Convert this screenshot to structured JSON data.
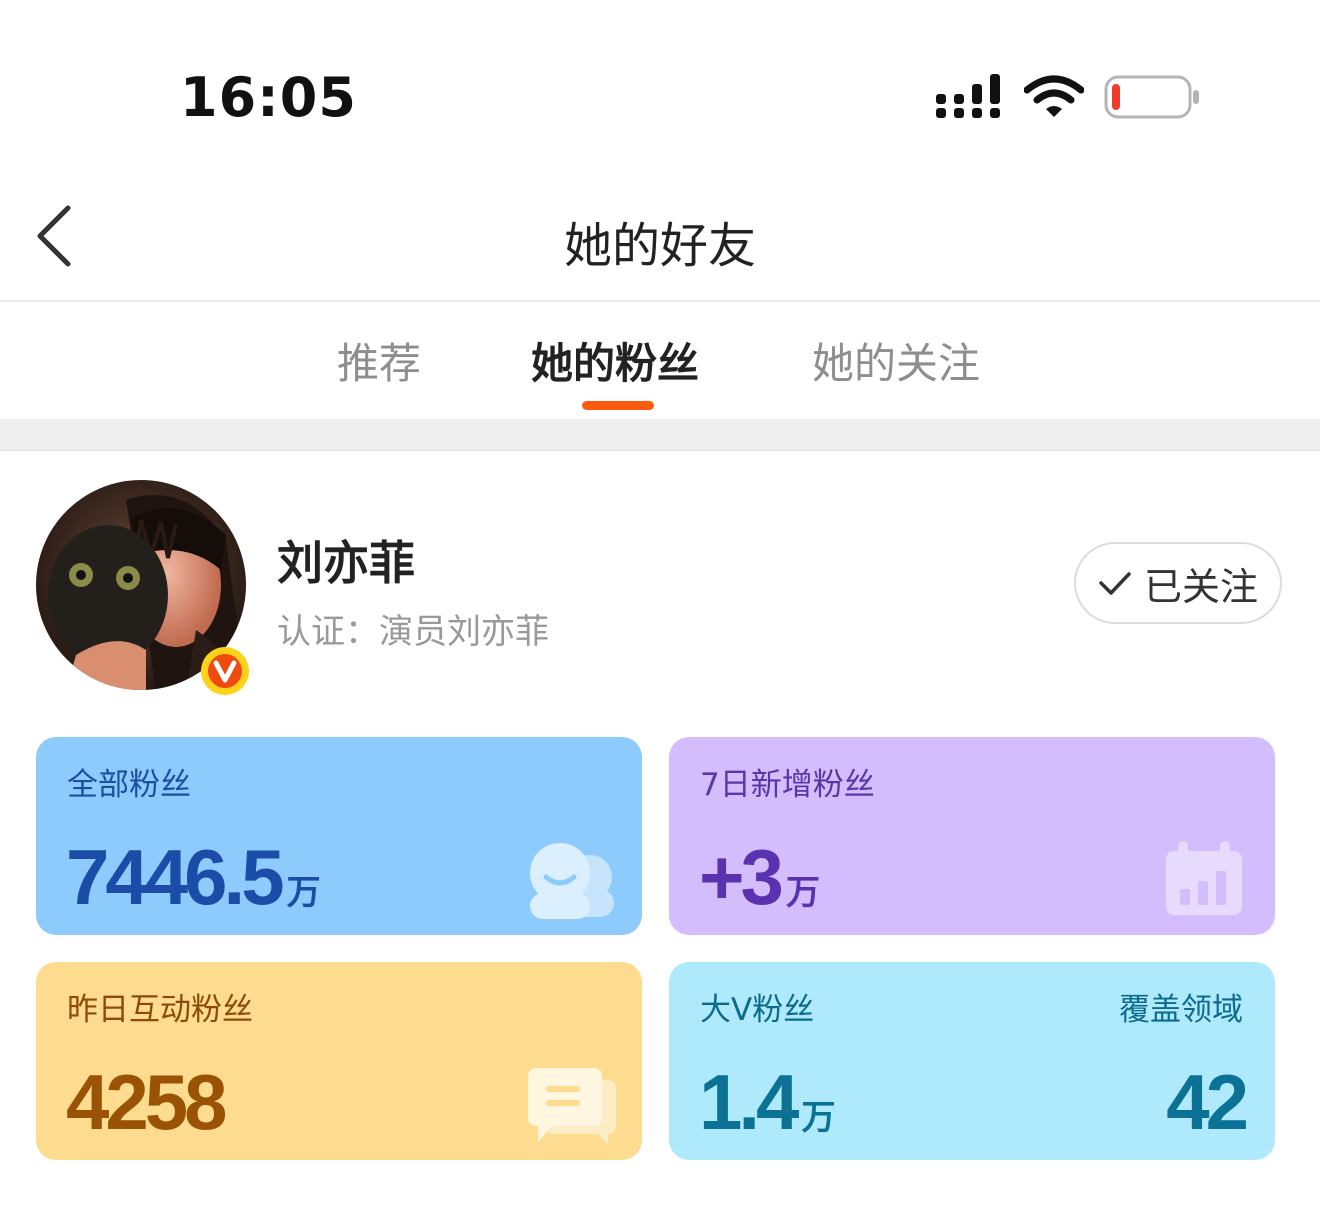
{
  "status_bar": {
    "time": "16:05",
    "signal_icon": "signal-bars-icon",
    "wifi_icon": "wifi-icon",
    "battery_icon": "battery-low-icon",
    "battery_level": 0.05
  },
  "nav": {
    "back_icon": "chevron-left-icon",
    "title": "她的好友"
  },
  "tabs": [
    {
      "label": "推荐",
      "active": false
    },
    {
      "label": "她的粉丝",
      "active": true
    },
    {
      "label": "她的关注",
      "active": false
    }
  ],
  "profile": {
    "name": "刘亦菲",
    "verification": "认证：演员刘亦菲",
    "badge_icon": "verified-v-icon",
    "follow_button": {
      "label": "已关注",
      "icon": "check-icon"
    }
  },
  "stats": {
    "total_fans": {
      "label": "全部粉丝",
      "value": "7446.5",
      "unit": "万",
      "icon": "fans-icon"
    },
    "new_fans_7d": {
      "label": "7日新增粉丝",
      "value": "+3",
      "unit": "万",
      "icon": "calendar-chart-icon"
    },
    "interactive_fans_yesterday": {
      "label": "昨日互动粉丝",
      "value": "4258",
      "icon": "chat-bubble-icon"
    },
    "big_v_fans": {
      "label": "大V粉丝",
      "value": "1.4",
      "unit": "万",
      "coverage_label": "覆盖领域",
      "coverage_value": "42"
    }
  },
  "colors": {
    "accent": "#ff5a0e",
    "card_blue": "#8ecbfd",
    "card_purple": "#d3bdfd",
    "card_yellow": "#fddb8f",
    "card_cyan": "#aeeafc",
    "battery_low": "#f23b2f"
  }
}
